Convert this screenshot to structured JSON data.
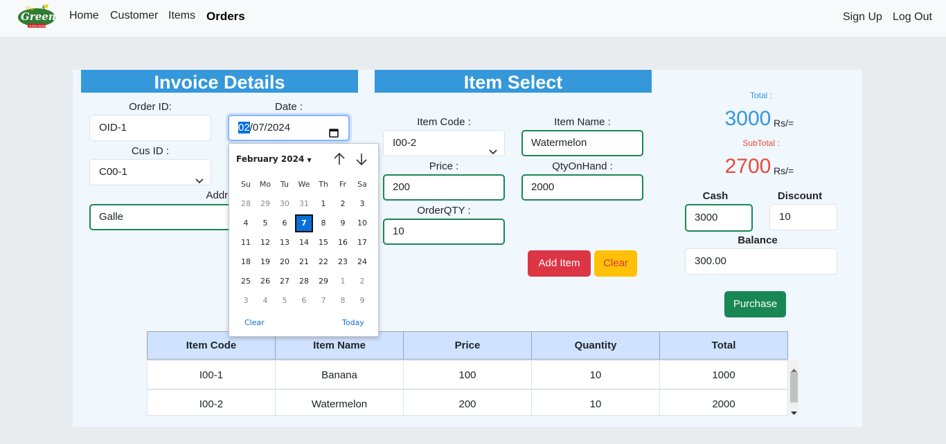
{
  "nav": {
    "logo_text": "Green",
    "logo_sub": "SUPER MARKET",
    "logo_top": "The",
    "links": [
      "Home",
      "Customer",
      "Items",
      "Orders"
    ],
    "right_links": [
      "Sign Up",
      "Log Out"
    ]
  },
  "invoice": {
    "title": "Invoice Details",
    "order_id_label": "Order ID:",
    "order_id_value": "OID-1",
    "date_label": "Date :",
    "date_month": "02",
    "date_rest": "/07/2024",
    "cus_id_label": "Cus ID :",
    "cus_id_value": "C00-1",
    "address_label": "Address",
    "address_value": "Galle"
  },
  "datepicker": {
    "month_year": "February 2024",
    "weekdays": [
      "Su",
      "Mo",
      "Tu",
      "We",
      "Th",
      "Fr",
      "Sa"
    ],
    "weeks": [
      [
        "28",
        "29",
        "30",
        "31",
        "1",
        "2",
        "3"
      ],
      [
        "4",
        "5",
        "6",
        "7",
        "8",
        "9",
        "10"
      ],
      [
        "11",
        "12",
        "13",
        "14",
        "15",
        "16",
        "17"
      ],
      [
        "18",
        "19",
        "20",
        "21",
        "22",
        "23",
        "24"
      ],
      [
        "25",
        "26",
        "27",
        "28",
        "29",
        "1",
        "2"
      ],
      [
        "3",
        "4",
        "5",
        "6",
        "7",
        "8",
        "9"
      ]
    ],
    "selected": "7",
    "clear_label": "Clear",
    "today_label": "Today"
  },
  "item_select": {
    "title": "Item Select",
    "item_code_label": "Item Code :",
    "item_code_value": "I00-2",
    "item_name_label": "Item Name :",
    "item_name_value": "Watermelon",
    "price_label": "Price :",
    "price_value": "200",
    "qty_on_hand_label": "QtyOnHand :",
    "qty_on_hand_value": "2000",
    "order_qty_label": "OrderQTY :",
    "order_qty_value": "10",
    "add_item_label": "Add Item",
    "clear_label": "Clear"
  },
  "summary": {
    "total_label": "Total :",
    "total_value": "3000",
    "subtotal_label": "SubTotal :",
    "subtotal_value": "2700",
    "currency": "Rs/=",
    "cash_label": "Cash",
    "cash_value": "3000",
    "discount_label": "Discount",
    "discount_value": "10",
    "balance_label": "Balance",
    "balance_value": "300.00",
    "purchase_label": "Purchase",
    "colors": {
      "total": "#3498db",
      "subtotal": "#e74c3c"
    }
  },
  "table": {
    "headers": [
      "Item Code",
      "Item Name",
      "Price",
      "Quantity",
      "Total"
    ],
    "rows": [
      [
        "I00-1",
        "Banana",
        "100",
        "10",
        "1000"
      ],
      [
        "I00-2",
        "Watermelon",
        "200",
        "10",
        "2000"
      ]
    ]
  }
}
